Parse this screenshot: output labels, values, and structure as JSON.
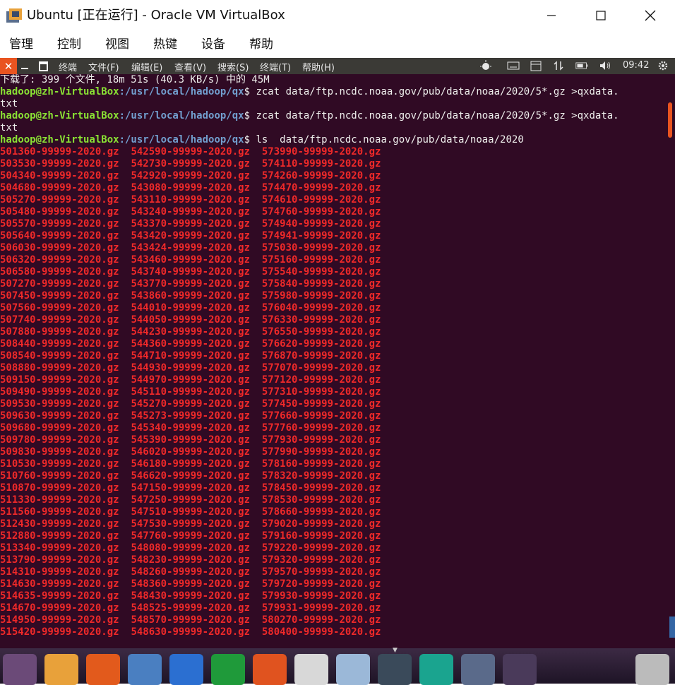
{
  "window": {
    "title": "Ubuntu [正在运行] - Oracle VM VirtualBox"
  },
  "vbox_menu": [
    "管理",
    "控制",
    "视图",
    "热键",
    "设备",
    "帮助"
  ],
  "ubuntu_panel": {
    "app_title": "终端",
    "menus": [
      "文件(F)",
      "编辑(E)",
      "查看(V)",
      "搜索(S)",
      "终端(T)",
      "帮助(H)"
    ],
    "clock": "09:42"
  },
  "terminal": {
    "lines": [
      "下载了: 399 个文件, 18m 51s (40.3 KB/s) 中的 45M"
    ],
    "prompts": [
      {
        "user": "hadoop@zh-VirtualBox",
        "path": ":/usr/local/hadoop/qx",
        "cmd": "$ zcat data/ftp.ncdc.noaa.gov/pub/data/noaa/2020/5*.gz >qxdata.",
        "wrap": "txt"
      },
      {
        "user": "hadoop@zh-VirtualBox",
        "path": ":/usr/local/hadoop/qx",
        "cmd": "$ zcat data/ftp.ncdc.noaa.gov/pub/data/noaa/2020/5*.gz >qxdata.",
        "wrap": "txt"
      },
      {
        "user": "hadoop@zh-VirtualBox",
        "path": ":/usr/local/hadoop/qx",
        "cmd": "$ ls  data/ftp.ncdc.noaa.gov/pub/data/noaa/2020",
        "wrap": null
      }
    ],
    "file_rows": [
      [
        "501360-99999-2020.gz",
        "542590-99999-2020.gz",
        "573990-99999-2020.gz"
      ],
      [
        "503530-99999-2020.gz",
        "542730-99999-2020.gz",
        "574110-99999-2020.gz"
      ],
      [
        "504340-99999-2020.gz",
        "542920-99999-2020.gz",
        "574260-99999-2020.gz"
      ],
      [
        "504680-99999-2020.gz",
        "543080-99999-2020.gz",
        "574470-99999-2020.gz"
      ],
      [
        "505270-99999-2020.gz",
        "543110-99999-2020.gz",
        "574610-99999-2020.gz"
      ],
      [
        "505480-99999-2020.gz",
        "543240-99999-2020.gz",
        "574760-99999-2020.gz"
      ],
      [
        "505570-99999-2020.gz",
        "543370-99999-2020.gz",
        "574940-99999-2020.gz"
      ],
      [
        "505640-99999-2020.gz",
        "543420-99999-2020.gz",
        "574941-99999-2020.gz"
      ],
      [
        "506030-99999-2020.gz",
        "543424-99999-2020.gz",
        "575030-99999-2020.gz"
      ],
      [
        "506320-99999-2020.gz",
        "543460-99999-2020.gz",
        "575160-99999-2020.gz"
      ],
      [
        "506580-99999-2020.gz",
        "543740-99999-2020.gz",
        "575540-99999-2020.gz"
      ],
      [
        "507270-99999-2020.gz",
        "543770-99999-2020.gz",
        "575840-99999-2020.gz"
      ],
      [
        "507450-99999-2020.gz",
        "543860-99999-2020.gz",
        "575980-99999-2020.gz"
      ],
      [
        "507560-99999-2020.gz",
        "544010-99999-2020.gz",
        "576040-99999-2020.gz"
      ],
      [
        "507740-99999-2020.gz",
        "544050-99999-2020.gz",
        "576330-99999-2020.gz"
      ],
      [
        "507880-99999-2020.gz",
        "544230-99999-2020.gz",
        "576550-99999-2020.gz"
      ],
      [
        "508440-99999-2020.gz",
        "544360-99999-2020.gz",
        "576620-99999-2020.gz"
      ],
      [
        "508540-99999-2020.gz",
        "544710-99999-2020.gz",
        "576870-99999-2020.gz"
      ],
      [
        "508880-99999-2020.gz",
        "544930-99999-2020.gz",
        "577070-99999-2020.gz"
      ],
      [
        "509150-99999-2020.gz",
        "544970-99999-2020.gz",
        "577120-99999-2020.gz"
      ],
      [
        "509490-99999-2020.gz",
        "545110-99999-2020.gz",
        "577310-99999-2020.gz"
      ],
      [
        "509530-99999-2020.gz",
        "545270-99999-2020.gz",
        "577450-99999-2020.gz"
      ],
      [
        "509630-99999-2020.gz",
        "545273-99999-2020.gz",
        "577660-99999-2020.gz"
      ],
      [
        "509680-99999-2020.gz",
        "545340-99999-2020.gz",
        "577760-99999-2020.gz"
      ],
      [
        "509780-99999-2020.gz",
        "545390-99999-2020.gz",
        "577930-99999-2020.gz"
      ],
      [
        "509830-99999-2020.gz",
        "546020-99999-2020.gz",
        "577990-99999-2020.gz"
      ],
      [
        "510530-99999-2020.gz",
        "546180-99999-2020.gz",
        "578160-99999-2020.gz"
      ],
      [
        "510760-99999-2020.gz",
        "546620-99999-2020.gz",
        "578320-99999-2020.gz"
      ],
      [
        "510870-99999-2020.gz",
        "547150-99999-2020.gz",
        "578450-99999-2020.gz"
      ],
      [
        "511330-99999-2020.gz",
        "547250-99999-2020.gz",
        "578530-99999-2020.gz"
      ],
      [
        "511560-99999-2020.gz",
        "547510-99999-2020.gz",
        "578660-99999-2020.gz"
      ],
      [
        "512430-99999-2020.gz",
        "547530-99999-2020.gz",
        "579020-99999-2020.gz"
      ],
      [
        "512880-99999-2020.gz",
        "547760-99999-2020.gz",
        "579160-99999-2020.gz"
      ],
      [
        "513340-99999-2020.gz",
        "548080-99999-2020.gz",
        "579220-99999-2020.gz"
      ],
      [
        "513790-99999-2020.gz",
        "548230-99999-2020.gz",
        "579320-99999-2020.gz"
      ],
      [
        "514310-99999-2020.gz",
        "548260-99999-2020.gz",
        "579570-99999-2020.gz"
      ],
      [
        "514630-99999-2020.gz",
        "548360-99999-2020.gz",
        "579720-99999-2020.gz"
      ],
      [
        "514635-99999-2020.gz",
        "548430-99999-2020.gz",
        "579930-99999-2020.gz"
      ],
      [
        "514670-99999-2020.gz",
        "548525-99999-2020.gz",
        "579931-99999-2020.gz"
      ],
      [
        "514950-99999-2020.gz",
        "548570-99999-2020.gz",
        "580270-99999-2020.gz"
      ],
      [
        "515420-99999-2020.gz",
        "548630-99999-2020.gz",
        "580400-99999-2020.gz"
      ]
    ]
  },
  "dock": {
    "items": [
      {
        "icon": "ubuntu-dash-icon",
        "color": "#6b4a78"
      },
      {
        "icon": "files-folder-icon",
        "color": "#e8a13a"
      },
      {
        "icon": "firefox-icon",
        "color": "#e25a1c"
      },
      {
        "icon": "chromium-icon",
        "color": "#4a7fc1"
      },
      {
        "icon": "writer-icon",
        "color": "#2b6fd1"
      },
      {
        "icon": "calc-icon",
        "color": "#1f9a3a"
      },
      {
        "icon": "impress-icon",
        "color": "#e0531f"
      },
      {
        "icon": "software-center-icon",
        "color": "#d8d8d8"
      },
      {
        "icon": "update-manager-icon",
        "color": "#9bb8d8"
      },
      {
        "icon": "terminal-icon",
        "color": "#3a4a5a"
      },
      {
        "icon": "system-icon",
        "color": "#1aa48f"
      },
      {
        "icon": "workspace-switcher-icon",
        "color": "#5a6a8a"
      },
      {
        "icon": "dvd-icon",
        "color": "#4a3a5a"
      },
      {
        "icon": "trash-icon",
        "color": "#bbbbbb"
      }
    ]
  }
}
